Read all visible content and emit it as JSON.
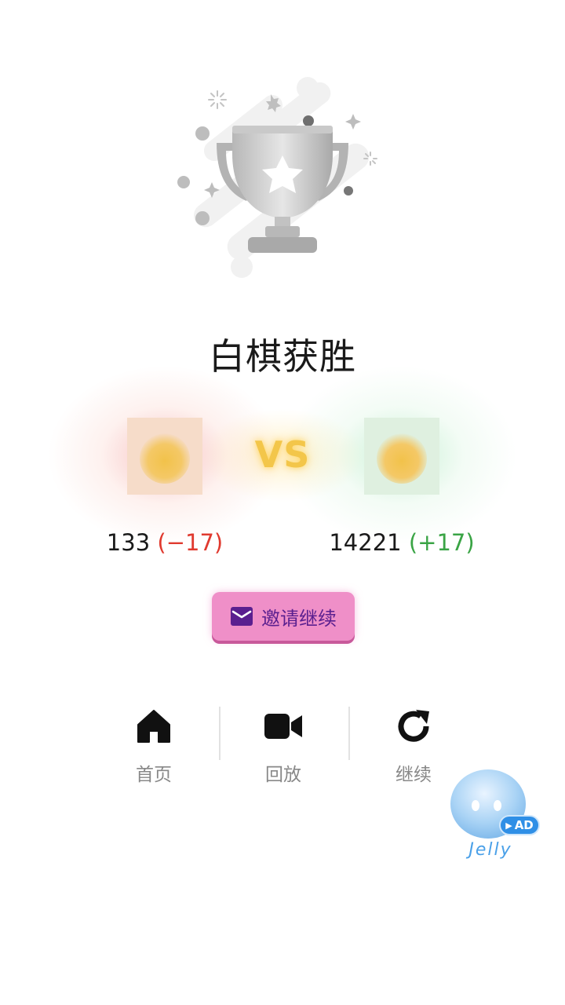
{
  "result": {
    "title": "白棋获胜"
  },
  "match": {
    "vs_label": "VS",
    "left_player": {
      "score": "133",
      "delta": "(−17)",
      "delta_color": "#e03a2f"
    },
    "right_player": {
      "score": "14221",
      "delta": "(+17)",
      "delta_color": "#3aa445"
    }
  },
  "invite_button": {
    "label": "邀请继续",
    "icon": "mail-icon",
    "color": "#ef8fc8"
  },
  "nav": {
    "home": {
      "label": "首页",
      "icon": "home-icon"
    },
    "replay": {
      "label": "回放",
      "icon": "video-camera-icon"
    },
    "continue": {
      "label": "继续",
      "icon": "refresh-icon"
    }
  },
  "ad": {
    "brand": "Jelly",
    "badge": "AD"
  }
}
